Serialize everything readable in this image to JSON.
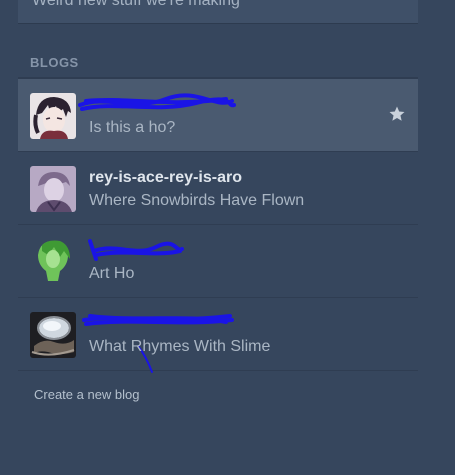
{
  "top_item": {
    "label": "Weird new stuff we're making"
  },
  "section": {
    "title": "BLOGS"
  },
  "blogs": [
    {
      "name": "",
      "title": "Is this a ho?",
      "active": true,
      "starred": true
    },
    {
      "name": "rey-is-ace-rey-is-aro",
      "title": "Where Snowbirds Have Flown"
    },
    {
      "name": "",
      "title": "Art Ho"
    },
    {
      "name": "",
      "title": "What Rhymes With Slime"
    }
  ],
  "create_link": {
    "label": "Create a new blog"
  },
  "colors": {
    "background": "#36465d",
    "active_row": "#4a5a70",
    "redaction": "#1a14e6"
  },
  "icons": [
    "star-icon"
  ]
}
